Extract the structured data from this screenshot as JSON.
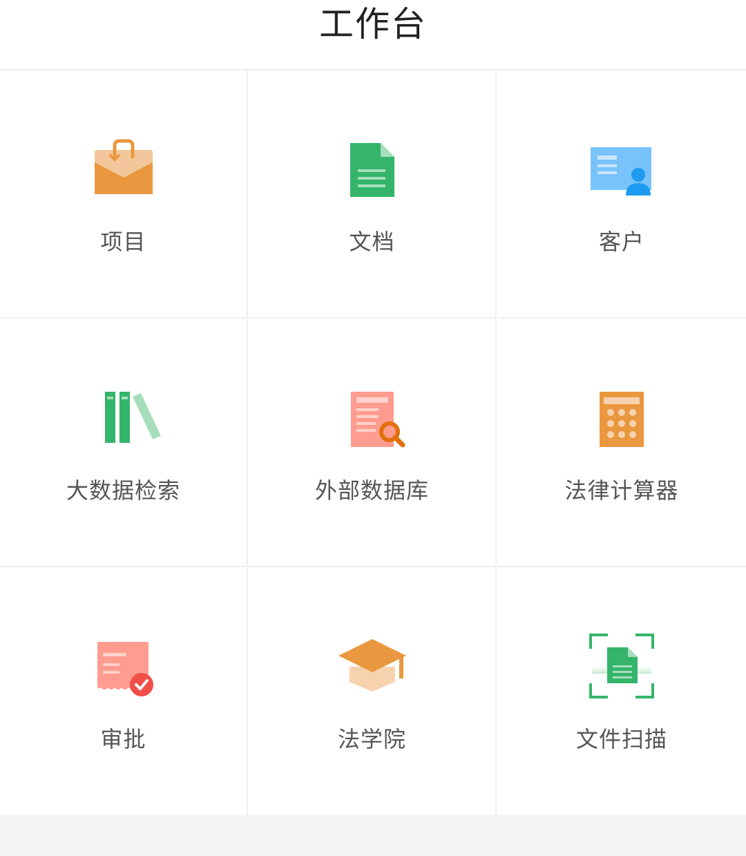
{
  "header": {
    "title": "工作台"
  },
  "colors": {
    "orange": "#E9983F",
    "green": "#34B56B",
    "blue": "#78C3FB",
    "red_light": "#FF9C8F",
    "dark_orange": "#E36F0C",
    "text": "#555555"
  },
  "grid": {
    "items": [
      {
        "label": "项目",
        "icon": "briefcase-icon"
      },
      {
        "label": "文档",
        "icon": "document-icon"
      },
      {
        "label": "客户",
        "icon": "contact-card-icon"
      },
      {
        "label": "大数据检索",
        "icon": "books-icon"
      },
      {
        "label": "外部数据库",
        "icon": "document-search-icon"
      },
      {
        "label": "法律计算器",
        "icon": "calculator-icon"
      },
      {
        "label": "审批",
        "icon": "approval-receipt-icon"
      },
      {
        "label": "法学院",
        "icon": "graduation-cap-icon"
      },
      {
        "label": "文件扫描",
        "icon": "document-scan-icon"
      }
    ]
  }
}
